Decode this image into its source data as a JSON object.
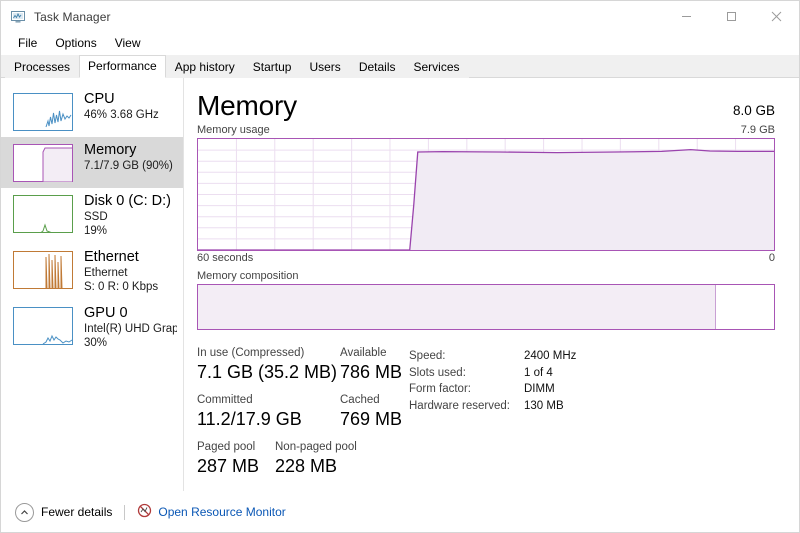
{
  "window": {
    "title": "Task Manager",
    "icon": "task-manager-icon",
    "minimize_label": "─",
    "maximize_label": "□",
    "close_label": "✕"
  },
  "menu": {
    "items": [
      {
        "label": "File"
      },
      {
        "label": "Options"
      },
      {
        "label": "View"
      }
    ]
  },
  "tabs": {
    "active": "Performance",
    "items": [
      {
        "label": "Processes"
      },
      {
        "label": "Performance"
      },
      {
        "label": "App history"
      },
      {
        "label": "Startup"
      },
      {
        "label": "Users"
      },
      {
        "label": "Details"
      },
      {
        "label": "Services"
      }
    ]
  },
  "sidebar": {
    "items": [
      {
        "name": "cpu",
        "title": "CPU",
        "sub1": "46%  3.68 GHz",
        "sub2": "",
        "color": "#4a90c4",
        "selected": false
      },
      {
        "name": "memory",
        "title": "Memory",
        "sub1": "7.1/7.9 GB (90%)",
        "sub2": "",
        "color": "#a855b5",
        "selected": true
      },
      {
        "name": "disk",
        "title": "Disk 0 (C: D:)",
        "sub1": "SSD",
        "sub2": "19%",
        "color": "#5a9e4b",
        "selected": false
      },
      {
        "name": "ethernet",
        "title": "Ethernet",
        "sub1": "Ethernet",
        "sub2": "S: 0 R: 0 Kbps",
        "color": "#c07a36",
        "selected": false
      },
      {
        "name": "gpu",
        "title": "GPU 0",
        "sub1": "Intel(R) UHD Grap...",
        "sub2": "30%",
        "color": "#4a90c4",
        "selected": false
      }
    ]
  },
  "main": {
    "title": "Memory",
    "total": "8.0 GB",
    "graph_caption": "Memory usage",
    "graph_max_label": "7.9 GB",
    "axis_left": "60 seconds",
    "axis_right": "0",
    "composition_caption": "Memory composition",
    "composition_used_percent": 90,
    "accent_color": "#a855b5",
    "fill_color": "#f3edf5"
  },
  "chart_data": {
    "type": "area",
    "title": "Memory usage",
    "xlabel": "",
    "ylabel": "",
    "ylim": [
      0,
      7.9
    ],
    "ytick_labels": [
      "7.9 GB"
    ],
    "xtick_labels": [
      "60 seconds",
      "0"
    ],
    "grid": true,
    "x_axis_direction": "right-to-left-time",
    "series": [
      {
        "name": "Memory in use (GB)",
        "points": [
          {
            "t": 60,
            "v": 0.0
          },
          {
            "t": 38,
            "v": 0.0
          },
          {
            "t": 37.5,
            "v": 0.0
          },
          {
            "t": 37,
            "v": 3.2
          },
          {
            "t": 36.6,
            "v": 7.0
          },
          {
            "t": 34,
            "v": 7.05
          },
          {
            "t": 28,
            "v": 7.02
          },
          {
            "t": 22,
            "v": 6.98
          },
          {
            "t": 16,
            "v": 7.0
          },
          {
            "t": 11,
            "v": 7.04
          },
          {
            "t": 8,
            "v": 7.12
          },
          {
            "t": 6,
            "v": 7.06
          },
          {
            "t": 3,
            "v": 7.05
          },
          {
            "t": 0,
            "v": 7.05
          }
        ]
      }
    ]
  },
  "stats": {
    "row1": [
      {
        "label": "In use (Compressed)",
        "value": "7.1 GB (35.2 MB)"
      },
      {
        "label": "Available",
        "value": "786 MB"
      }
    ],
    "row2": [
      {
        "label": "Committed",
        "value": "11.2/17.9 GB"
      },
      {
        "label": "Cached",
        "value": "769 MB"
      }
    ],
    "row3": [
      {
        "label": "Paged pool",
        "value": "287 MB"
      },
      {
        "label": "Non-paged pool",
        "value": "228 MB"
      }
    ]
  },
  "specs": [
    {
      "label": "Speed:",
      "value": "2400 MHz"
    },
    {
      "label": "Slots used:",
      "value": "1 of 4"
    },
    {
      "label": "Form factor:",
      "value": "DIMM"
    },
    {
      "label": "Hardware reserved:",
      "value": "130 MB"
    }
  ],
  "footer": {
    "fewer_details": "Fewer details",
    "resource_monitor": "Open Resource Monitor"
  }
}
